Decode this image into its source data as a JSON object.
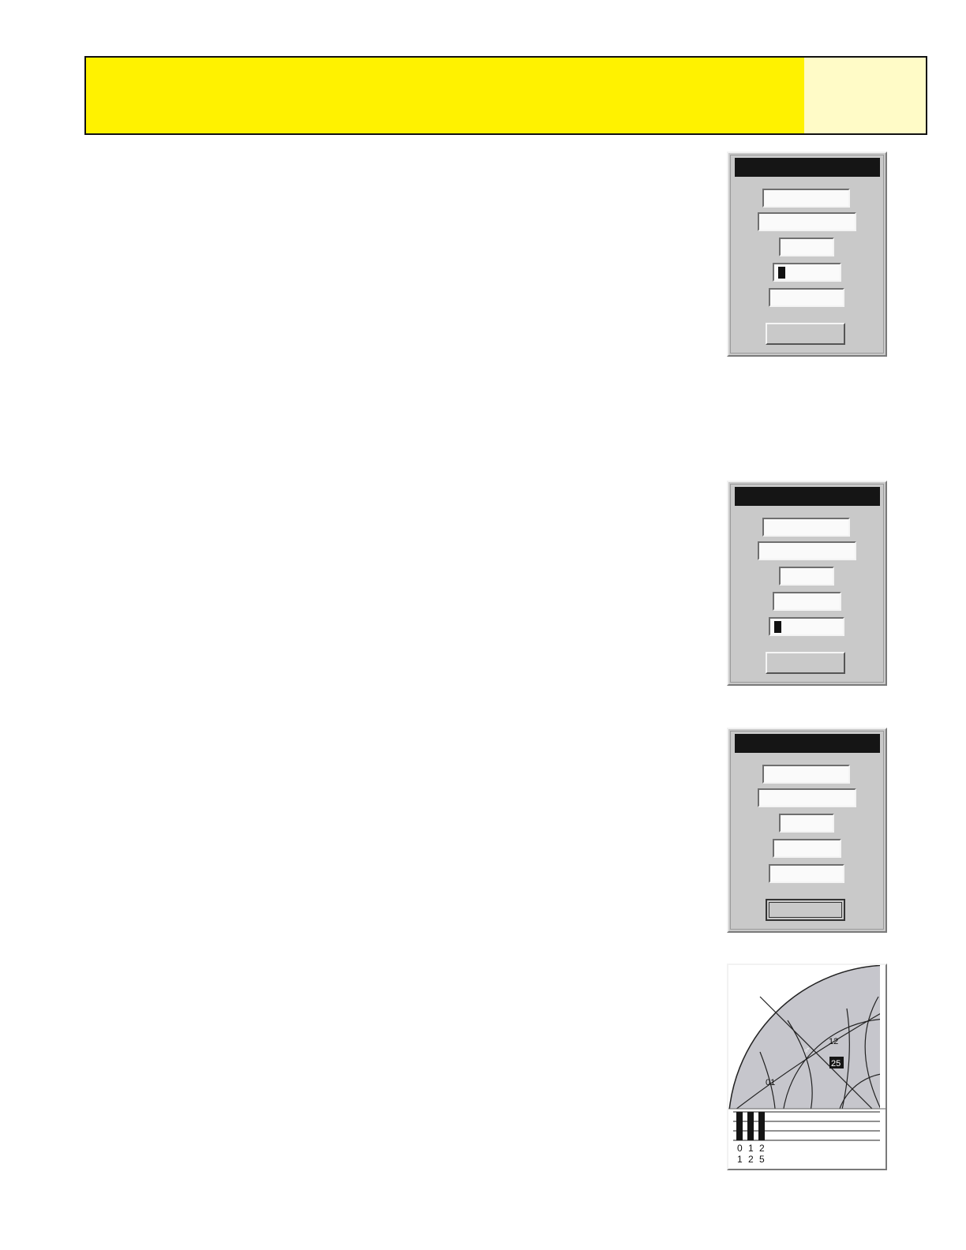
{
  "colors": {
    "banner_main": "#fff200",
    "banner_tab": "#fffbc7",
    "screen_body": "#c9c9c9",
    "title_bar": "#151515",
    "sky_fill": "#c6c6cc"
  },
  "screens": [
    {
      "id": "screen-1",
      "cursor_field": 4,
      "focused_button": false
    },
    {
      "id": "screen-2",
      "cursor_field": 5,
      "focused_button": false
    },
    {
      "id": "screen-3",
      "cursor_field": 0,
      "focused_button": true
    }
  ],
  "sky_view": {
    "satellites": [
      {
        "id": "01",
        "highlighted": false
      },
      {
        "id": "12",
        "highlighted": false
      },
      {
        "id": "25",
        "highlighted": true
      }
    ],
    "signal_bars": [
      {
        "label_top": "0",
        "label_bottom": "1",
        "level": 1.0
      },
      {
        "label_top": "1",
        "label_bottom": "2",
        "level": 1.0
      },
      {
        "label_top": "2",
        "label_bottom": "5",
        "level": 1.0
      }
    ]
  }
}
